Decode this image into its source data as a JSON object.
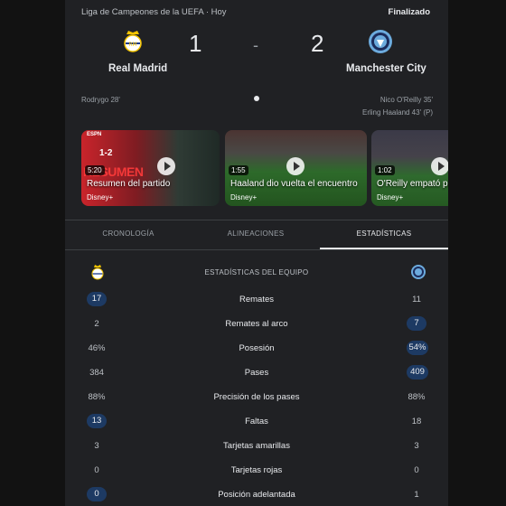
{
  "match": {
    "competition": "Liga de Campeones de la UEFA · Hoy",
    "status": "Finalizado",
    "home": {
      "name": "Real Madrid",
      "score": "1",
      "scorers": [
        "Rodrygo 28'"
      ],
      "crest_colors": [
        "#ffffff",
        "#f4c400",
        "#1b3a8c"
      ]
    },
    "away": {
      "name": "Manchester City",
      "score": "2",
      "scorers": [
        "Nico O'Reilly 35'",
        "Erling Haaland 43' (P)"
      ],
      "crest_colors": [
        "#6cabdd",
        "#ffffff",
        "#1c2c5b"
      ]
    },
    "separator": "-"
  },
  "videos": [
    {
      "title": "Resumen del partido",
      "duration": "5:20",
      "source": "Disney+",
      "thumb_colors": [
        "#c9242b",
        "#2f3b35"
      ],
      "overlay": "RESUMEN",
      "score_overlay": "1-2",
      "network": "ESPN"
    },
    {
      "title": "Haaland dio vuelta el encuentro",
      "duration": "1:55",
      "source": "Disney+",
      "thumb_colors": [
        "#2d6a2a",
        "#4b3432"
      ]
    },
    {
      "title": "O'Reilly empató pa",
      "duration": "1:02",
      "source": "Disney+",
      "thumb_colors": [
        "#2f6a2e",
        "#3b3a48"
      ]
    }
  ],
  "tabs": [
    {
      "label": "CRONOLOGÍA",
      "active": false
    },
    {
      "label": "ALINEACIONES",
      "active": false
    },
    {
      "label": "ESTADÍSTICAS",
      "active": true
    }
  ],
  "stats": {
    "header": "ESTADÍSTICAS DEL EQUIPO",
    "highlight_color": "#1d3a63",
    "rows": [
      {
        "label": "Remates",
        "home": "17",
        "away": "11",
        "highlight": "home"
      },
      {
        "label": "Remates al arco",
        "home": "2",
        "away": "7",
        "highlight": "away"
      },
      {
        "label": "Posesión",
        "home": "46%",
        "away": "54%",
        "highlight": "away"
      },
      {
        "label": "Pases",
        "home": "384",
        "away": "409",
        "highlight": "away"
      },
      {
        "label": "Precisión de los pases",
        "home": "88%",
        "away": "88%",
        "highlight": ""
      },
      {
        "label": "Faltas",
        "home": "13",
        "away": "18",
        "highlight": "home"
      },
      {
        "label": "Tarjetas amarillas",
        "home": "3",
        "away": "3",
        "highlight": ""
      },
      {
        "label": "Tarjetas rojas",
        "home": "0",
        "away": "0",
        "highlight": ""
      },
      {
        "label": "Posición adelantada",
        "home": "0",
        "away": "1",
        "highlight": "home"
      }
    ]
  },
  "icons": [
    "real-madrid-crest-icon",
    "manchester-city-crest-icon",
    "ball-icon",
    "play-icon"
  ]
}
